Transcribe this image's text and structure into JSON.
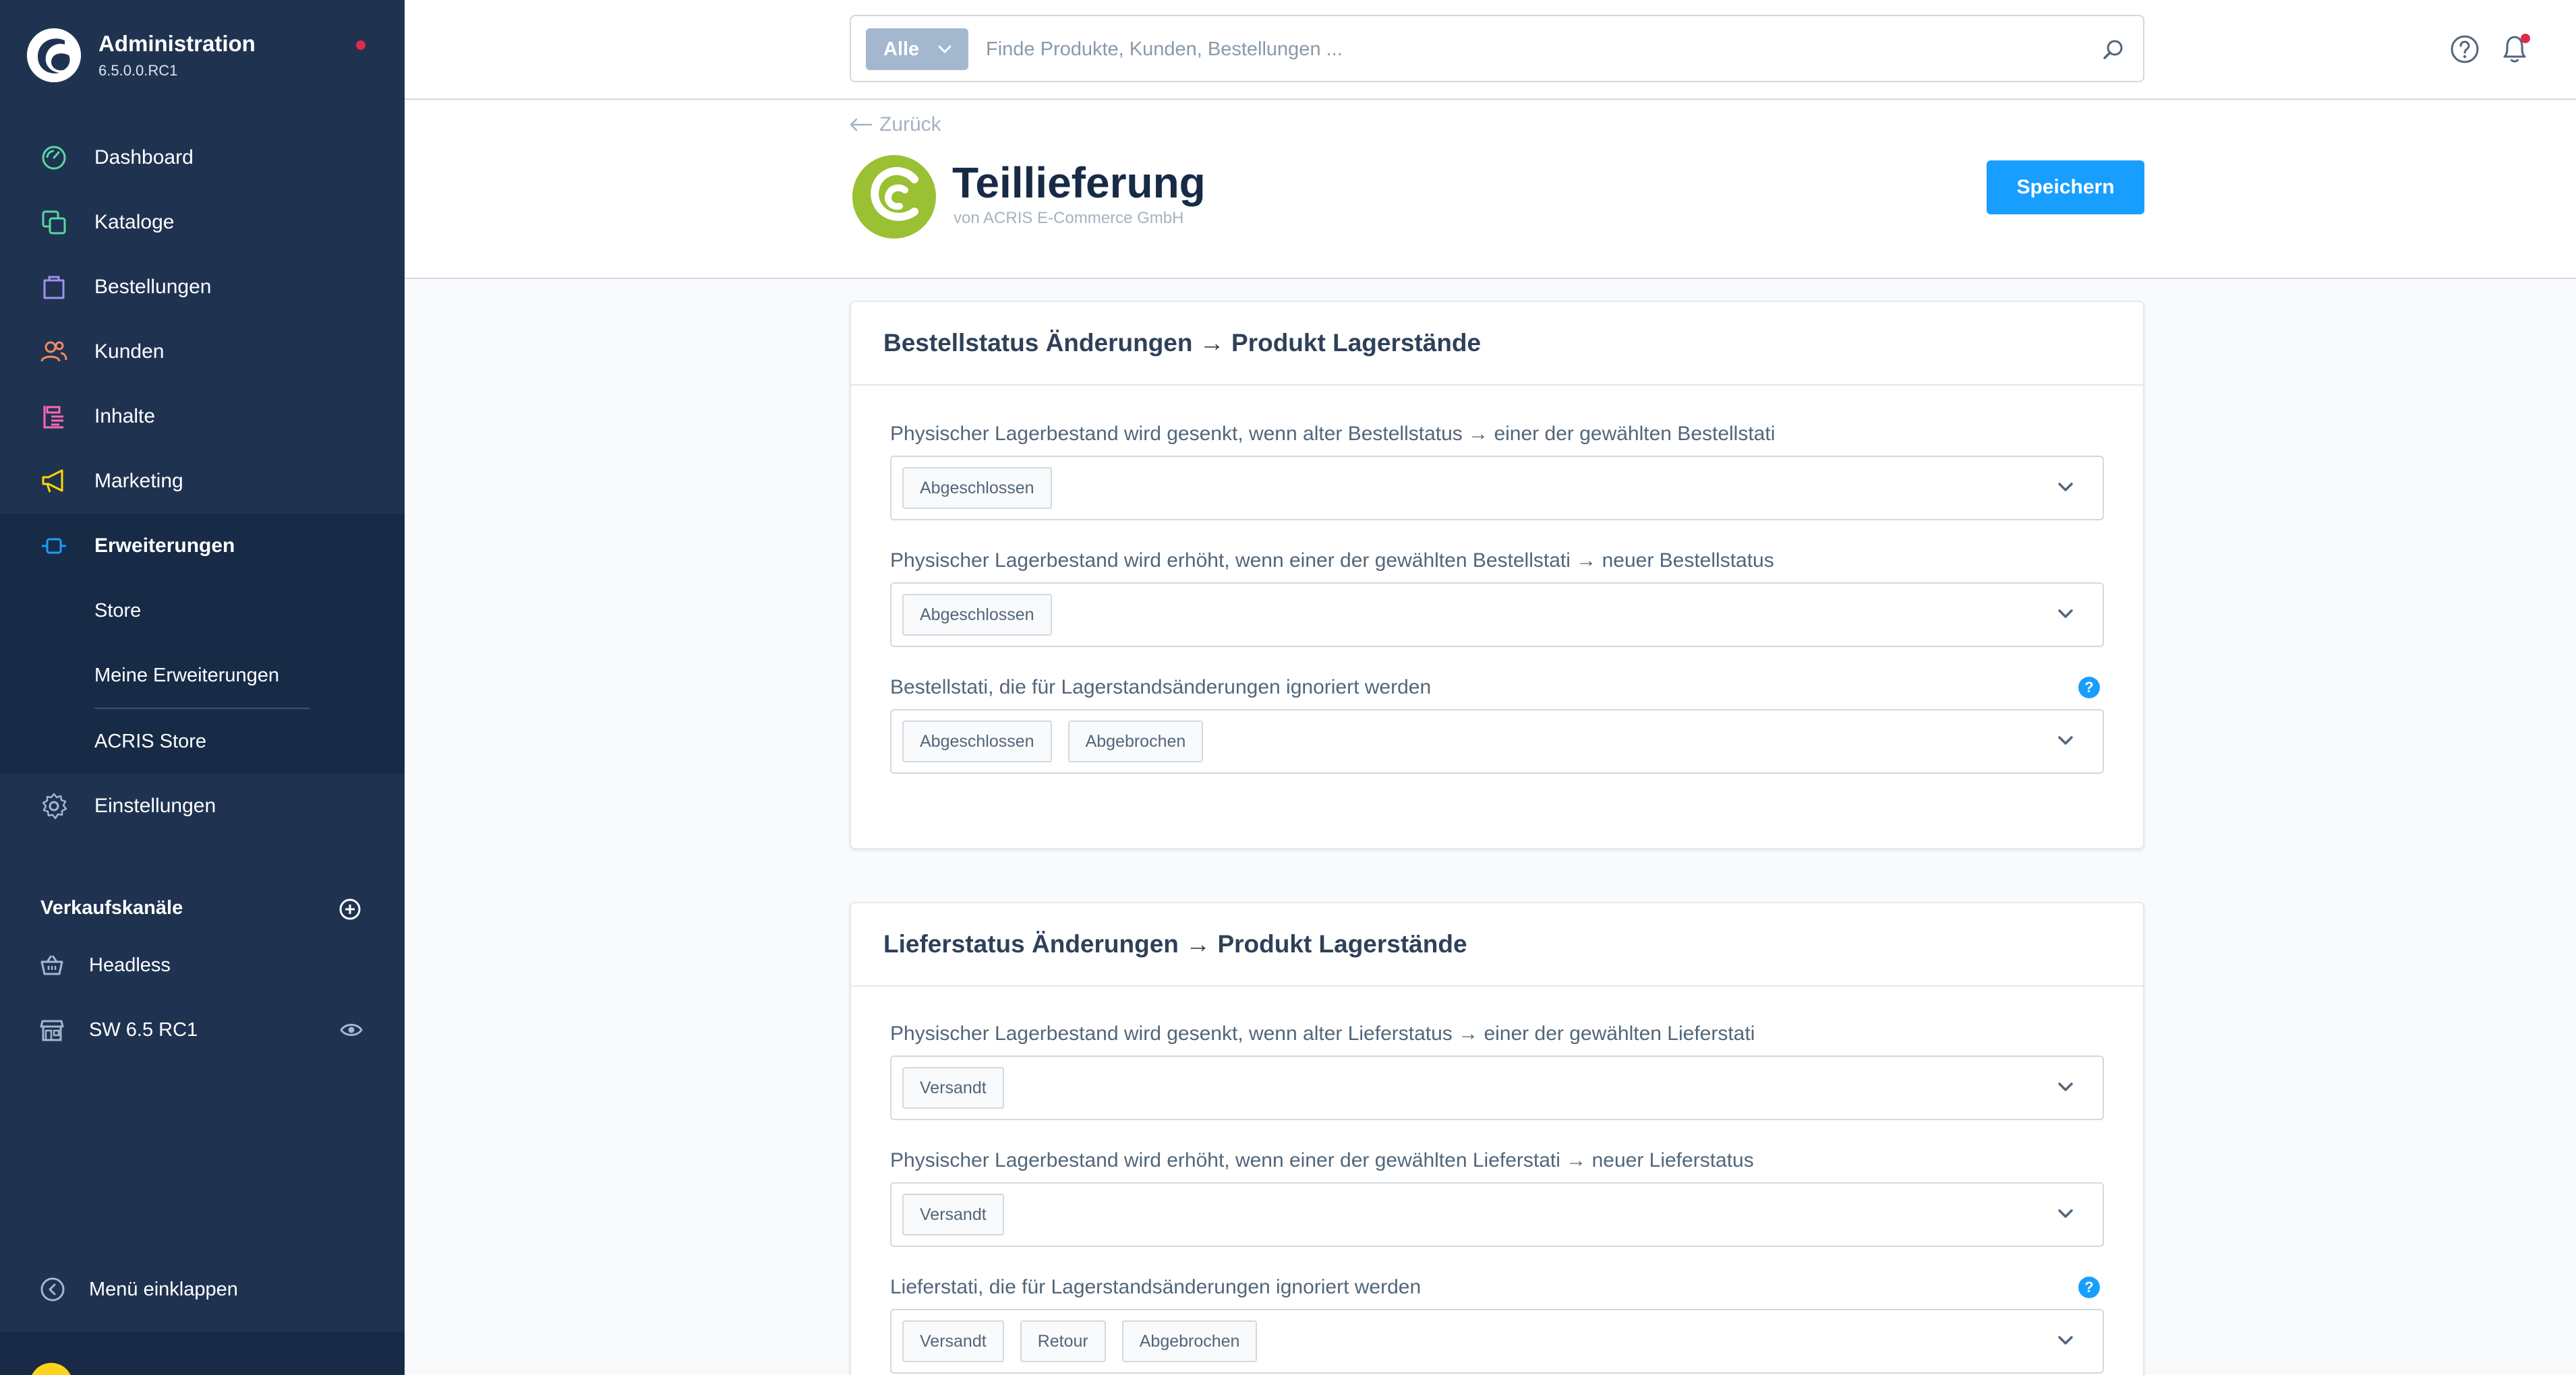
{
  "brand": {
    "title": "Administration",
    "version": "6.5.0.0.RC1"
  },
  "nav": {
    "items": [
      {
        "label": "Dashboard",
        "icon": "dashboard-icon",
        "color": "#57d9a3"
      },
      {
        "label": "Kataloge",
        "icon": "catalog-icon",
        "color": "#57d9a3"
      },
      {
        "label": "Bestellungen",
        "icon": "orders-icon",
        "color": "#a092f0"
      },
      {
        "label": "Kunden",
        "icon": "customers-icon",
        "color": "#f88962"
      },
      {
        "label": "Inhalte",
        "icon": "content-icon",
        "color": "#ff68b4"
      },
      {
        "label": "Marketing",
        "icon": "marketing-icon",
        "color": "#ffd700"
      },
      {
        "label": "Erweiterungen",
        "icon": "extensions-icon",
        "color": "#189eff"
      }
    ],
    "sub_items": [
      "Store",
      "Meine Erweiterungen",
      "ACRIS Store"
    ],
    "settings": "Einstellungen"
  },
  "channels": {
    "title": "Verkaufskanäle",
    "items": [
      {
        "label": "Headless",
        "icon": "basket-icon"
      },
      {
        "label": "SW 6.5 RC1",
        "icon": "storefront-icon"
      }
    ]
  },
  "collapse_label": "Menü einklappen",
  "search": {
    "type_label": "Alle",
    "placeholder": "Finde Produkte, Kunden, Bestellungen ..."
  },
  "header": {
    "back": "Zurück",
    "title": "Teillieferung",
    "vendor": "von ACRIS E-Commerce GmbH",
    "save": "Speichern",
    "accent": "#189eff"
  },
  "cards": [
    {
      "title": "Bestellstatus Änderungen → Produkt Lagerstände",
      "fields": [
        {
          "label": "Physischer Lagerbestand wird gesenkt, wenn alter Bestellstatus → einer der gewählten Bestellstati",
          "tags": [
            "Abgeschlossen"
          ]
        },
        {
          "label": "Physischer Lagerbestand wird erhöht, wenn einer der gewählten Bestellstati → neuer Bestellstatus",
          "tags": [
            "Abgeschlossen"
          ]
        },
        {
          "label": "Bestellstati, die für Lagerstandsänderungen ignoriert werden",
          "tags": [
            "Abgeschlossen",
            "Abgebrochen"
          ],
          "help": "?"
        }
      ]
    },
    {
      "title": "Lieferstatus Änderungen → Produkt Lagerstände",
      "fields": [
        {
          "label": "Physischer Lagerbestand wird gesenkt, wenn alter Lieferstatus → einer der gewählten Lieferstati",
          "tags": [
            "Versandt"
          ]
        },
        {
          "label": "Physischer Lagerbestand wird erhöht, wenn einer der gewählten Lieferstati → neuer Lieferstatus",
          "tags": [
            "Versandt"
          ]
        },
        {
          "label": "Lieferstati, die für Lagerstandsänderungen ignoriert werden",
          "tags": [
            "Versandt",
            "Retour",
            "Abgebrochen"
          ],
          "help": "?"
        }
      ]
    }
  ]
}
